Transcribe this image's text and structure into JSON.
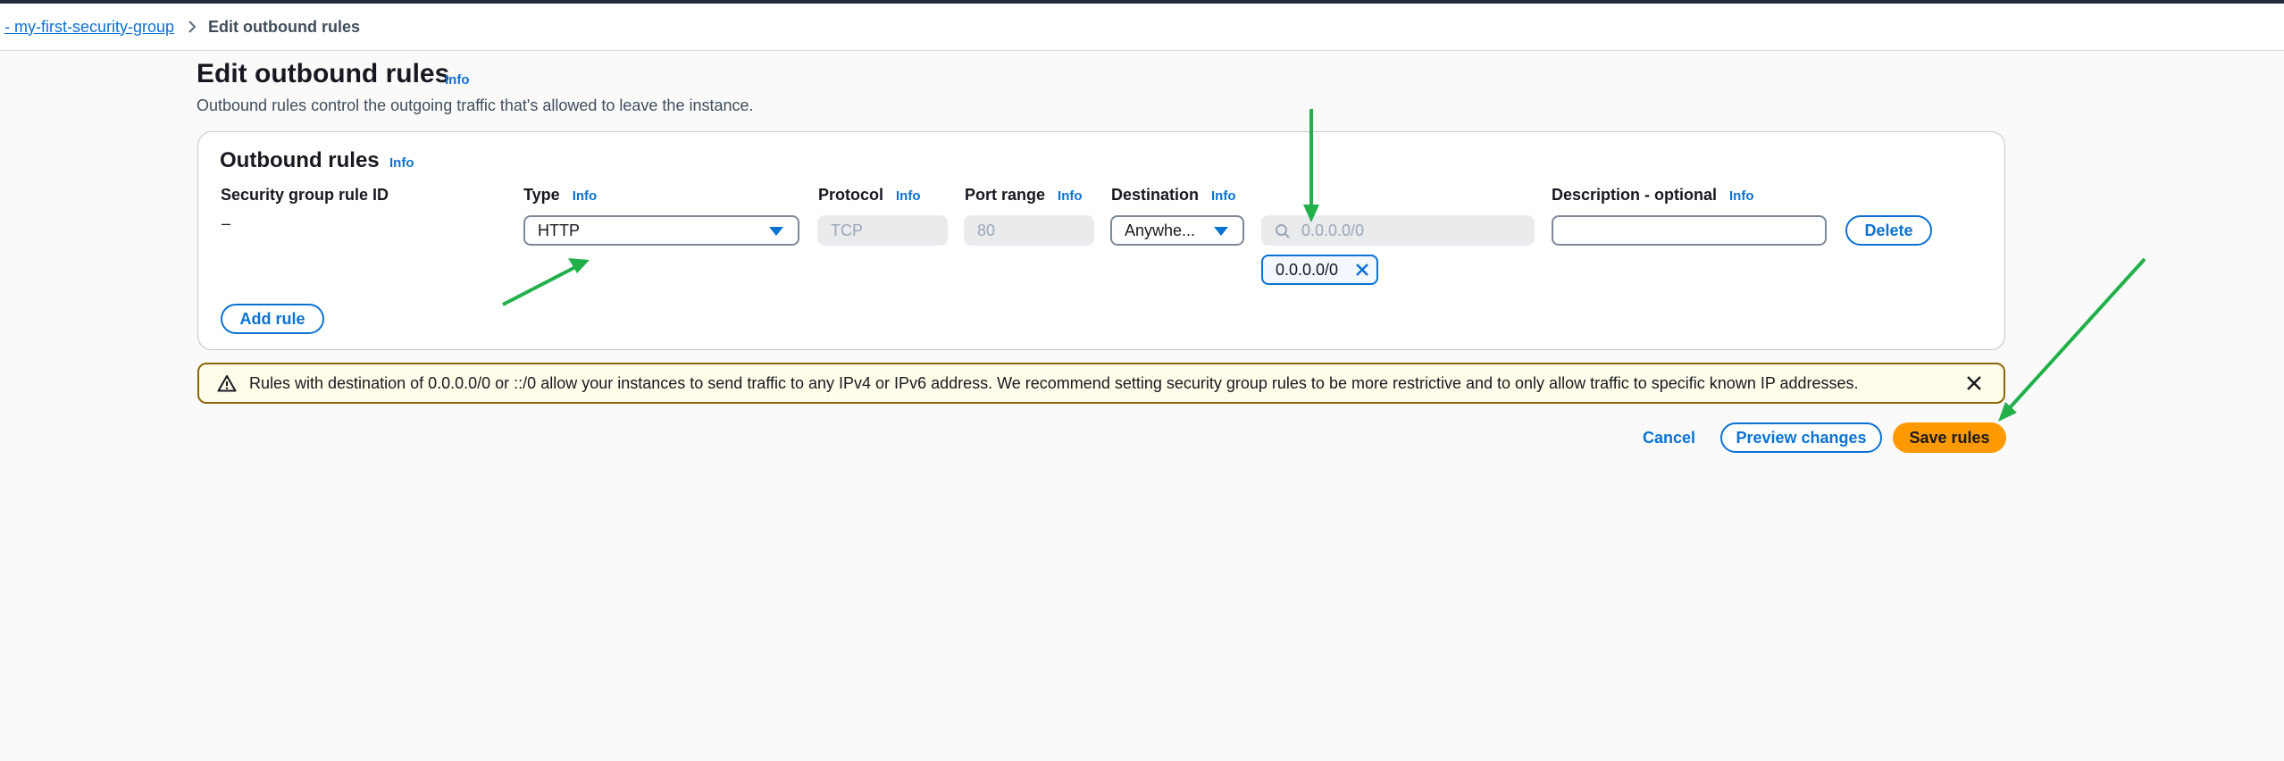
{
  "breadcrumb": {
    "parent": "- my-first-security-group",
    "current": "Edit outbound rules"
  },
  "page": {
    "title": "Edit outbound rules",
    "title_info": "Info",
    "description": "Outbound rules control the outgoing traffic that's allowed to leave the instance."
  },
  "panel": {
    "title": "Outbound rules",
    "title_info": "Info",
    "columns": {
      "rule_id": "Security group rule ID",
      "type": "Type",
      "type_info": "Info",
      "protocol": "Protocol",
      "protocol_info": "Info",
      "port_range": "Port range",
      "port_range_info": "Info",
      "destination": "Destination",
      "destination_info": "Info",
      "description": "Description - optional",
      "description_info": "Info"
    },
    "rule": {
      "rule_id": "–",
      "type": "HTTP",
      "protocol": "TCP",
      "port_range": "80",
      "destination": "Anywhe...",
      "cidr_placeholder": "0.0.0.0/0",
      "cidr_token": "0.0.0.0/0",
      "description": ""
    },
    "delete_label": "Delete",
    "add_rule_label": "Add rule"
  },
  "alert": {
    "text": "Rules with destination of 0.0.0.0/0 or ::/0 allow your instances to send traffic to any IPv4 or IPv6 address. We recommend setting security group rules to be more restrictive and to only allow traffic to specific known IP addresses."
  },
  "actions": {
    "cancel": "Cancel",
    "preview": "Preview changes",
    "save": "Save rules"
  },
  "colors": {
    "link": "#0972d3",
    "primary": "#ff9900",
    "warning_border": "#8d6605",
    "warning_bg": "#fffce9",
    "annotation_arrow": "#22b04b"
  },
  "icons": [
    "chevron-right-icon",
    "caret-down-icon",
    "search-icon",
    "close-icon",
    "warning-icon",
    "annotation-arrow"
  ]
}
